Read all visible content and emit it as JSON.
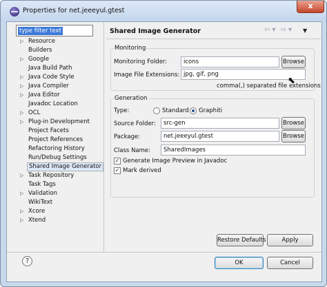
{
  "window": {
    "title": "Properties for net.jeeeyul.gtest",
    "close_label": "x"
  },
  "filter": {
    "placeholder": "type filter text"
  },
  "tree": [
    {
      "label": "Resource",
      "arrow": "▷"
    },
    {
      "label": "Builders",
      "arrow": ""
    },
    {
      "label": "Google",
      "arrow": "▷"
    },
    {
      "label": "Java Build Path",
      "arrow": ""
    },
    {
      "label": "Java Code Style",
      "arrow": "▷"
    },
    {
      "label": "Java Compiler",
      "arrow": "▷"
    },
    {
      "label": "Java Editor",
      "arrow": "▷"
    },
    {
      "label": "Javadoc Location",
      "arrow": ""
    },
    {
      "label": "OCL",
      "arrow": "▷"
    },
    {
      "label": "Plug-in Development",
      "arrow": "▷"
    },
    {
      "label": "Project Facets",
      "arrow": ""
    },
    {
      "label": "Project References",
      "arrow": ""
    },
    {
      "label": "Refactoring History",
      "arrow": ""
    },
    {
      "label": "Run/Debug Settings",
      "arrow": ""
    },
    {
      "label": "Shared Image Generator",
      "arrow": ""
    },
    {
      "label": "Task Repository",
      "arrow": "▷"
    },
    {
      "label": "Task Tags",
      "arrow": ""
    },
    {
      "label": "Validation",
      "arrow": "▷"
    },
    {
      "label": "WikiText",
      "arrow": ""
    },
    {
      "label": "Xcore",
      "arrow": "▷"
    },
    {
      "label": "Xtend",
      "arrow": "▷"
    }
  ],
  "page": {
    "title": "Shared Image Generator",
    "nav": {
      "back": "⇦",
      "back_menu": "▾",
      "forward": "⇨",
      "forward_menu": "▾",
      "view_menu": "▼"
    }
  },
  "monitoring": {
    "group_label": "Monitoring",
    "folder_label": "Monitoring Folder:",
    "folder_value": "icons",
    "browse_label": "Browse",
    "extensions_label": "Image File Extensions:",
    "extensions_value": "jpg, gif, png",
    "hint": "comma(,) separated file extensions"
  },
  "generation": {
    "group_label": "Generation",
    "type_label": "Type:",
    "type_options": [
      "Standard",
      "Graphiti"
    ],
    "type_selected": "Graphiti",
    "source_folder_label": "Source Folder:",
    "source_folder_value": "src-gen",
    "browse_label": "Browse",
    "package_label": "Package:",
    "package_value": "net.jeeeyul.gtest",
    "class_name_label": "Class Name:",
    "class_name_value": "SharedImages",
    "preview_checkbox": {
      "label": "Generate Image Preview in Javadoc",
      "checked": true
    },
    "derived_checkbox": {
      "label": "Mark derived",
      "checked": true
    },
    "check_mark": "✓"
  },
  "buttons": {
    "restore_defaults": "Restore Defaults",
    "apply": "Apply",
    "ok": "OK",
    "cancel": "Cancel"
  },
  "help": {
    "symbol": "?"
  }
}
